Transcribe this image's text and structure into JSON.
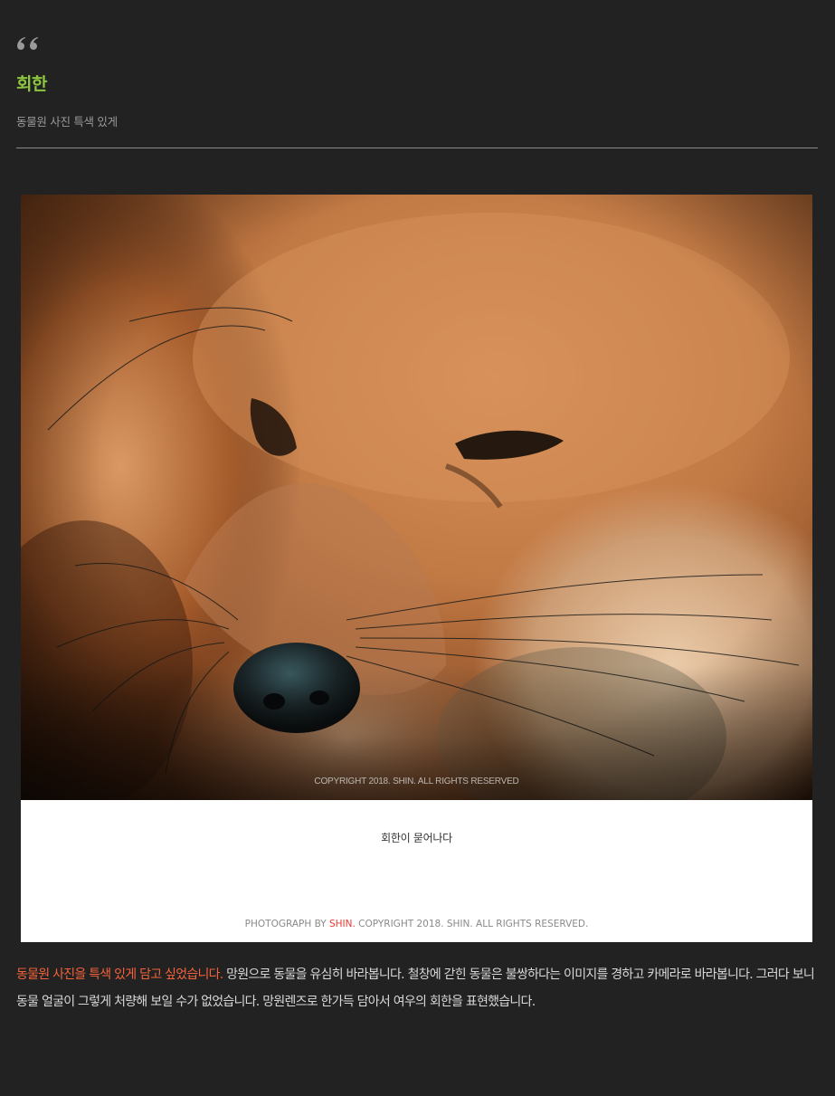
{
  "post": {
    "title": "회한",
    "subtitle": "동물원 사진 특색 있게"
  },
  "photo": {
    "icon": "fox-photo",
    "watermark": "COPYRIGHT 2018. SHIN. ALL RIGHTS RESERVED",
    "caption": "회한이 묻어나다",
    "credit_prefix": "PHOTOGRAPH  BY ",
    "credit_name": "SHIN.",
    "credit_suffix": "  COPYRIGHT 2018. SHIN. ALL  RIGHTS  RESERVED."
  },
  "body": {
    "highlight": "동물원 사진을 특색 있게 담고 싶었습니다.",
    "text": " 망원으로 동물을 유심히 바라봅니다. 철창에 갇힌 동물은 불쌍하다는 이미지를 경하고 카메라로 바라봅니다. 그러다 보니 동물 얼굴이 그렇게 처량해 보일 수가 없었습니다. 망원렌즈로 한가득 담아서 여우의 회한을 표현했습니다."
  },
  "colors": {
    "background": "#222222",
    "title": "#8dc63f",
    "highlight": "#f4623a",
    "credit_name": "#e53935"
  }
}
